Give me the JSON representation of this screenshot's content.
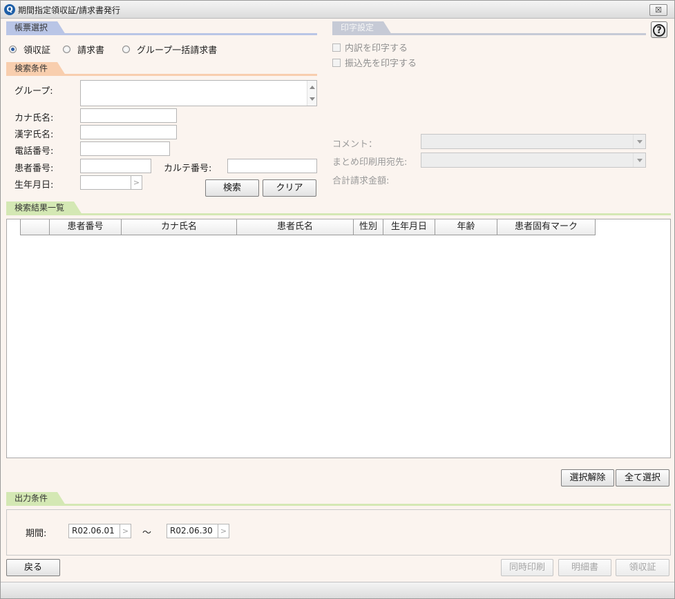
{
  "window": {
    "title": "期間指定領収証/請求書発行",
    "close_label": "☒"
  },
  "form_select": {
    "header": "帳票選択",
    "options": [
      {
        "label": "領収証",
        "selected": true
      },
      {
        "label": "請求書",
        "selected": false
      },
      {
        "label": "グループ一括請求書",
        "selected": false
      }
    ]
  },
  "print_settings": {
    "header": "印字設定",
    "checkboxes": [
      {
        "label": "内訳を印字する",
        "checked": false
      },
      {
        "label": "振込先を印字する",
        "checked": false
      }
    ],
    "comment_label": "コメント：",
    "summary_label": "まとめ印刷用宛先:",
    "total_label": "合計請求金額:"
  },
  "search": {
    "header": "検索条件",
    "group_label": "グループ:",
    "kana_label": "カナ氏名:",
    "kanji_label": "漢字氏名:",
    "phone_label": "電話番号:",
    "patient_no_label": "患者番号:",
    "chart_no_label": "カルテ番号:",
    "birth_label": "生年月日:",
    "search_button": "検索",
    "clear_button": "クリア"
  },
  "results": {
    "header": "検索結果一覧",
    "columns": [
      "",
      "患者番号",
      "カナ氏名",
      "患者氏名",
      "性別",
      "生年月日",
      "年齢",
      "患者固有マーク"
    ],
    "deselect_button": "選択解除",
    "select_all_button": "全て選択"
  },
  "output": {
    "header": "出力条件",
    "period_label": "期間:",
    "from": "R02.06.01",
    "separator": "～",
    "to": "R02.06.30"
  },
  "footer": {
    "back_button": "戻る",
    "simultaneous_print_button": "同時印刷",
    "detail_button": "明細書",
    "receipt_button": "領収証"
  },
  "help_label": "?"
}
